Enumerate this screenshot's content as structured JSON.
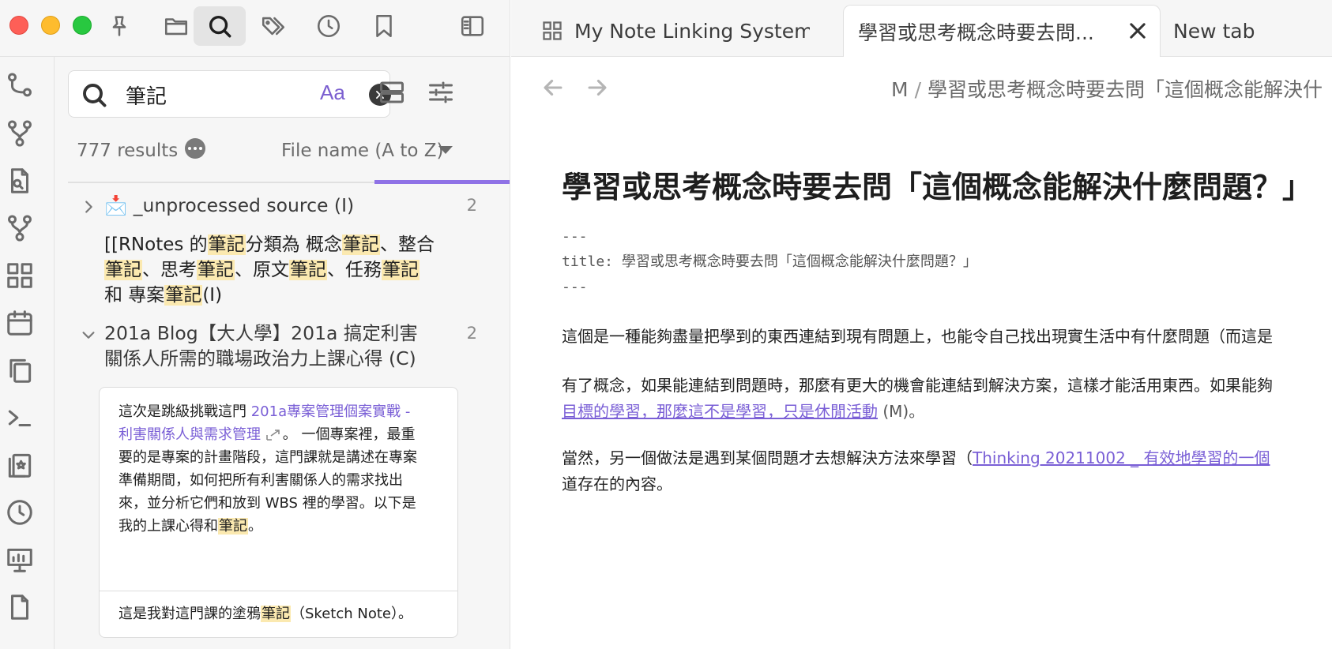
{
  "window": {
    "toolbar_icons": [
      "pin-icon",
      "folder-icon",
      "search-icon",
      "tag-icon",
      "clock-icon",
      "bookmark-icon",
      "sidebar-toggle-icon"
    ]
  },
  "tabs": [
    {
      "label": "My Note Linking System",
      "icon": "grid-icon"
    },
    {
      "label": "學習或思考概念時要去問...",
      "active": true
    },
    {
      "label": "New tab"
    }
  ],
  "ribbon": {
    "icons": [
      "graph-nodes-icon",
      "git-branch-icon",
      "file-search-icon",
      "git-branch-icon",
      "dashboard-icon",
      "calendar-icon",
      "copy-icon",
      "terminal-icon",
      "bookmark-stack-icon",
      "history-icon",
      "presentation-icon",
      "document-icon"
    ]
  },
  "search": {
    "query": "筆記",
    "case_label": "Aa",
    "results_count": "777 results",
    "sort_label": "File name (A to Z)",
    "progress_color": "#8f72e6",
    "groups": [
      {
        "title": "📩 _unprocessed source (I)",
        "count": "2",
        "expanded": false,
        "match_segments": [
          "[[RNotes 的",
          "筆記",
          "分類為 概念",
          "筆記",
          "、整合",
          "筆記",
          "、思考",
          "筆記",
          "、原文",
          "筆記",
          "、任務",
          "筆記",
          "和 專案",
          "筆記",
          "(I)"
        ]
      },
      {
        "title": "201a Blog【大人學】201a 搞定利害關係人所需的職場政治力上課心得 (C)",
        "title_line1": "201a Blog【大人學】201a 搞定利害",
        "title_line2": "關係人所需的職場政治力上課心得 (C)",
        "count": "2",
        "expanded": true,
        "preview1": {
          "before": "這次是跳級挑戰這門 ",
          "link_line1": "201a專案管理個案實戰 -",
          "link_line2": "利害關係人與需求管理",
          "after_link": "。 一個專案裡，最重",
          "line3": "要的是專案的計畫階段，這門課就是講述在專案",
          "line4": "準備期間，如何把所有利害關係人的需求找出",
          "line5": "來，並分析它們和放到 WBS 裡的學習。以下是",
          "line6_before": "我的上課心得和",
          "line6_hl": "筆記",
          "line6_after": "。"
        },
        "preview2": {
          "before": "這是我對這門課的塗鴉",
          "hl": "筆記",
          "after": "（Sketch Note）。"
        }
      }
    ]
  },
  "main": {
    "breadcrumb_root": "M",
    "breadcrumb_sep": "/",
    "breadcrumb_current": "學習或思考概念時要去問「這個概念能解決什",
    "title": "學習或思考概念時要去問「這個概念能解決什麼問題？」",
    "frontmatter_line1": "---",
    "frontmatter_line2": "title: 學習或思考概念時要去問「這個概念能解決什麼問題？」",
    "frontmatter_line3": "---",
    "para1": "這個是一種能夠盡量把學到的東西連結到現有問題上，也能令自己找出現實生活中有什麼問題（而這是",
    "para2_line1": "有了概念，如果能連結到問題時，那麼有更大的機會能連結到解決方案，這樣才能活用東西。如果能夠",
    "para2_link": "目標的學習，那麼這不是學習，只是休閒活動",
    "para2_annot": " (M)。",
    "para3_before": "當然，另一個做法是遇到某個問題才去想解決方法來學習（",
    "para3_link": "Thinking 20211002 _ 有效地學習的一個",
    "para3_line2": "道存在的內容。"
  },
  "colors": {
    "accent": "#7a5fd6",
    "highlight": "#fbe9b0",
    "traffic_red": "#fe5f57",
    "traffic_yellow": "#febc2e",
    "traffic_green": "#28c840"
  }
}
